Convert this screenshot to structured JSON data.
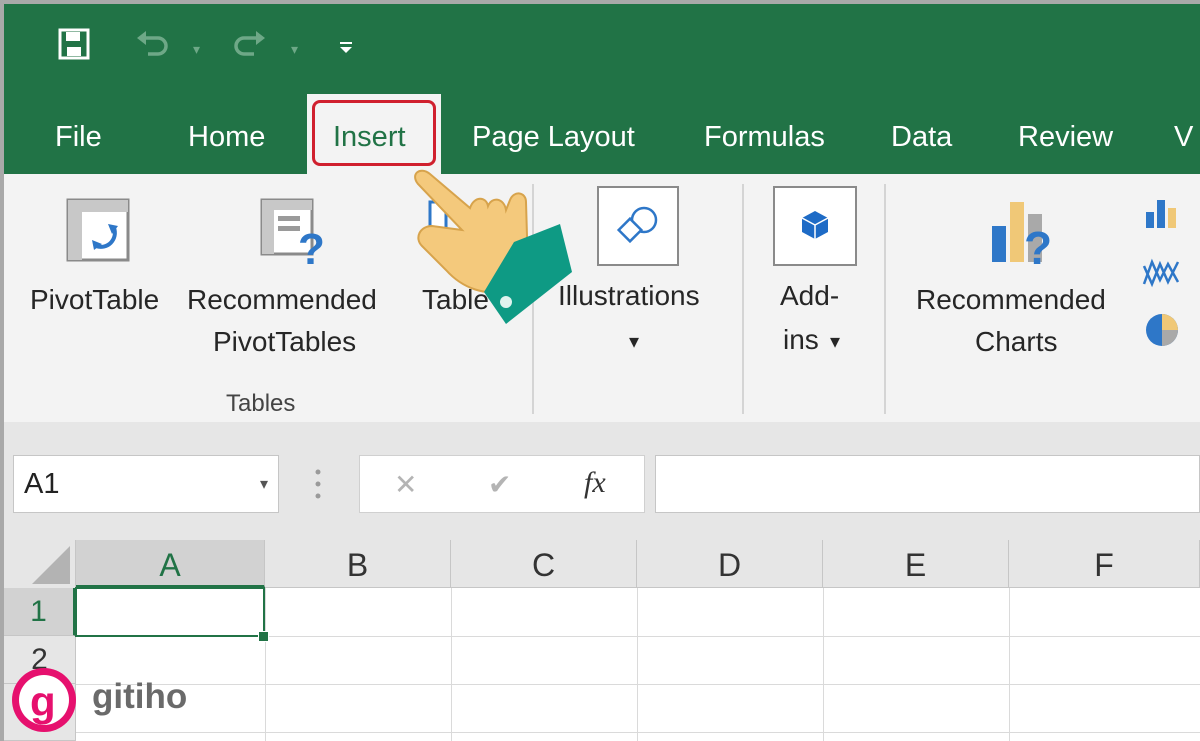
{
  "qat": {
    "save_icon": "save-icon",
    "undo_icon": "undo-icon",
    "redo_icon": "redo-icon",
    "customize_icon": "customize-qat-icon"
  },
  "tabs": [
    {
      "label": "File"
    },
    {
      "label": "Home"
    },
    {
      "label": "Insert",
      "active": true
    },
    {
      "label": "Page Layout"
    },
    {
      "label": "Formulas"
    },
    {
      "label": "Data"
    },
    {
      "label": "Review"
    },
    {
      "label": "V"
    }
  ],
  "ribbon": {
    "tables": {
      "group_label": "Tables",
      "pivottable_label": "PivotTable",
      "recommended_line1": "Recommended",
      "recommended_line2": "PivotTables",
      "table_label": "Table"
    },
    "illustrations_label": "Illustrations",
    "addins_line1": "Add-",
    "addins_line2": "ins",
    "charts": {
      "recommended_line1": "Recommended",
      "recommended_line2": "Charts"
    },
    "dropdown_glyph": "▾"
  },
  "formula_bar": {
    "name_box_value": "A1",
    "cancel_glyph": "✕",
    "enter_glyph": "✔",
    "fx_label": "fx",
    "formula_value": ""
  },
  "grid": {
    "columns": [
      "A",
      "B",
      "C",
      "D",
      "E",
      "F"
    ],
    "rows": [
      "1",
      "2"
    ],
    "active_cell": "A1"
  },
  "watermark": {
    "brand": "gitiho",
    "logo_letter": "g"
  },
  "colors": {
    "excel_green": "#217346",
    "highlight_red": "#d0202e",
    "hand_skin": "#f4c97c",
    "cuff_teal": "#0e9a84"
  }
}
